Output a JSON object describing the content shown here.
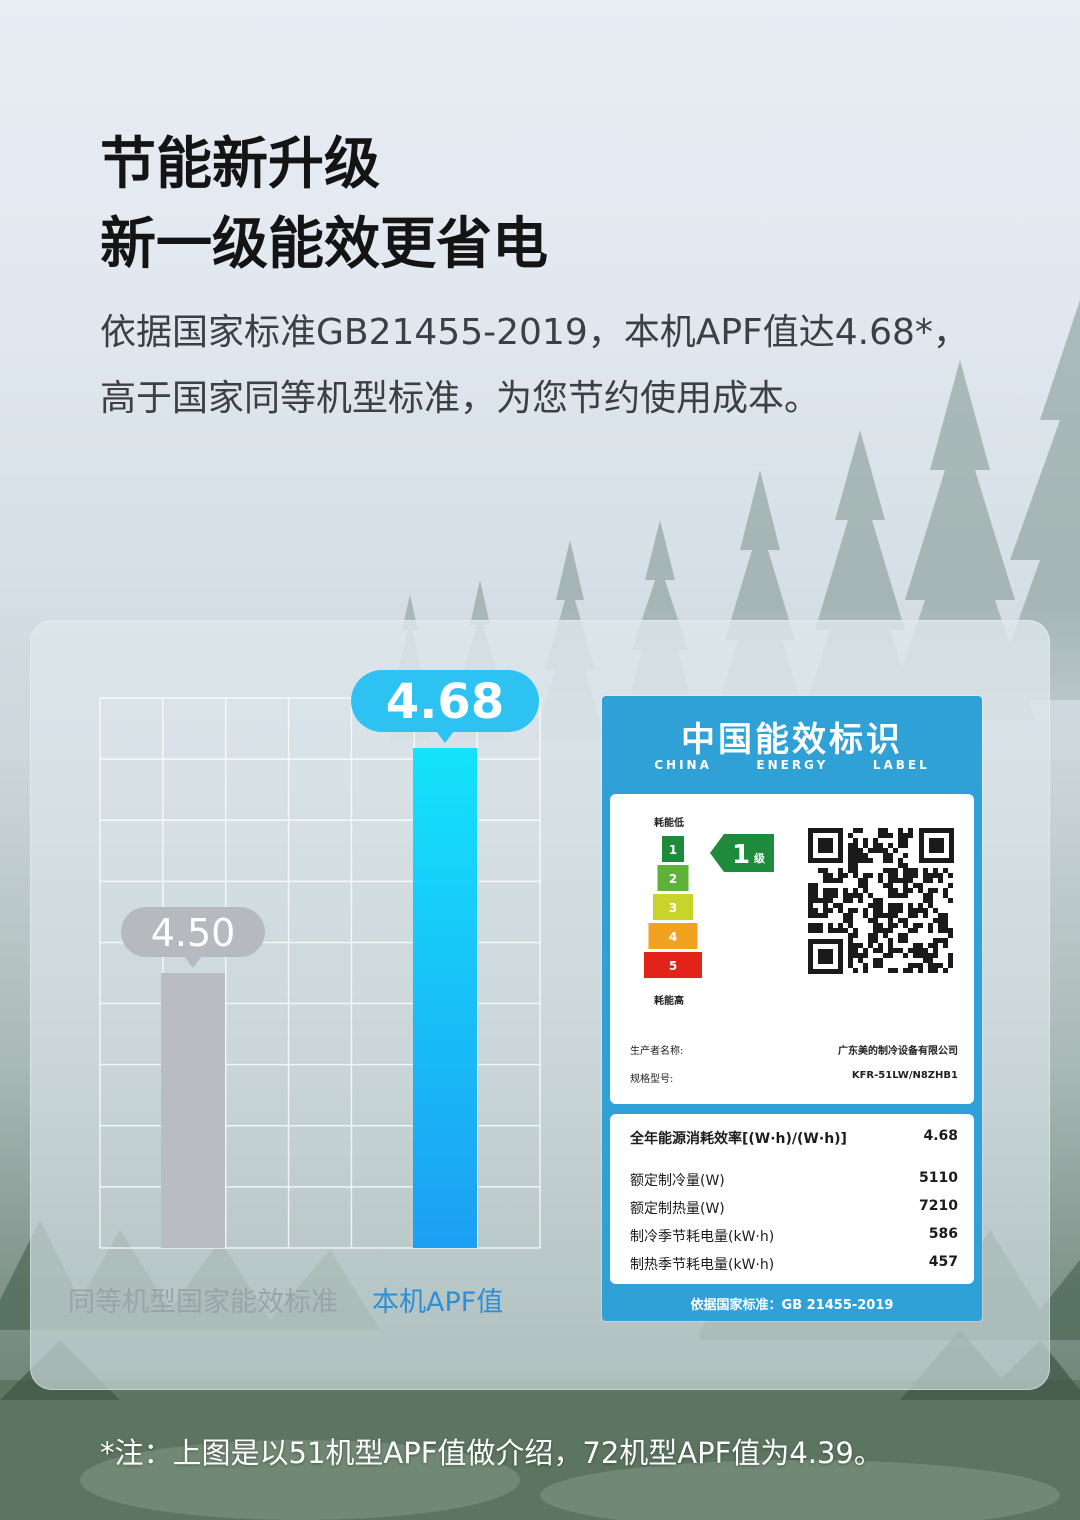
{
  "headline": {
    "line1": "节能新升级",
    "line2": "新一级能效更省电"
  },
  "description": "依据国家标准GB21455-2019，本机APF值达4.68*，高于国家同等机型标准，为您节约使用成本。",
  "chart_data": {
    "type": "bar",
    "categories": [
      "同等机型国家能效标准",
      "本机APF值"
    ],
    "values": [
      4.5,
      4.68
    ],
    "value_labels": [
      "4.50",
      "4.68"
    ],
    "title": "",
    "xlabel": "",
    "ylabel": "",
    "grid": true,
    "bar_colors": [
      "#b9bdc2",
      "#19a9f5"
    ],
    "label_colors": [
      "#9aa3a8",
      "#2e8fd6"
    ],
    "bubble_colors": [
      "#b6babf",
      "#2ec2f3"
    ]
  },
  "energy_label": {
    "title": "中国能效标识",
    "subtitle": [
      "CHINA",
      "ENERGY",
      "LABEL"
    ],
    "low_text": "耗能低",
    "high_text": "耗能高",
    "grades": [
      "1",
      "2",
      "3",
      "4",
      "5"
    ],
    "grade_colors": [
      "#1e8a3c",
      "#5db23a",
      "#c9d42a",
      "#f3a21f",
      "#e2231a"
    ],
    "current_grade": "1",
    "current_grade_suffix": "级",
    "manufacturer_label": "生产者名称:",
    "manufacturer": "广东美的制冷设备有限公司",
    "model_label": "规格型号:",
    "model": "KFR-51LW/N8ZHB1",
    "rows": [
      {
        "label": "全年能源消耗效率[(W·h)/(W·h)]",
        "value": "4.68"
      },
      {
        "label": "额定制冷量(W)",
        "value": "5110"
      },
      {
        "label": "额定制热量(W)",
        "value": "7210"
      },
      {
        "label": "制冷季节耗电量(kW·h)",
        "value": "586"
      },
      {
        "label": "制热季节耗电量(kW·h)",
        "value": "457"
      }
    ],
    "footer": "依据国家标准：GB 21455-2019",
    "brand_color": "#2fa1d6"
  },
  "note": "*注：上图是以51机型APF值做介绍，72机型APF值为4.39。"
}
